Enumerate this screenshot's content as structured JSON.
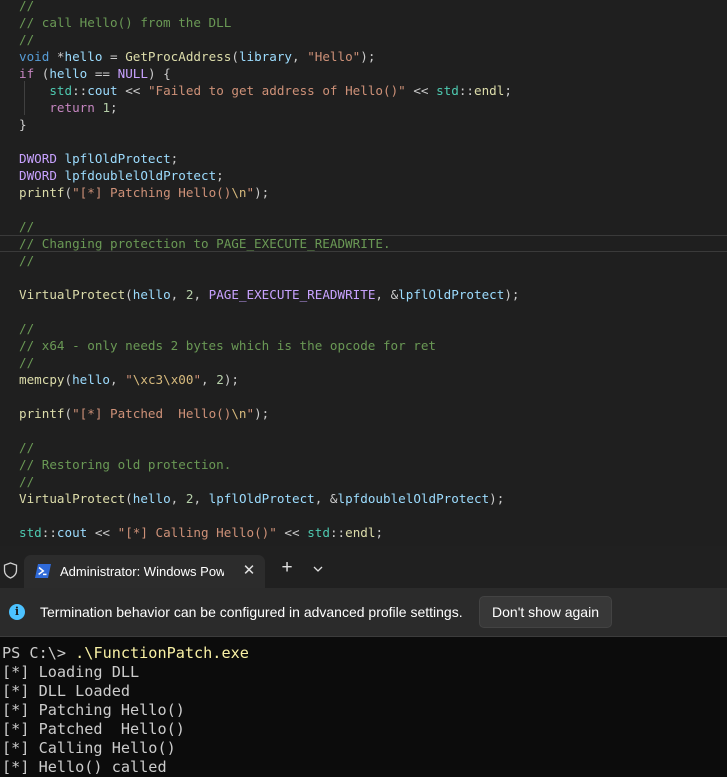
{
  "editor": {
    "lines": [
      [
        {
          "t": "//",
          "c": "comment"
        }
      ],
      [
        {
          "t": "// call Hello() from the DLL",
          "c": "comment"
        }
      ],
      [
        {
          "t": "//",
          "c": "comment"
        }
      ],
      [
        {
          "t": "void",
          "c": "keyword"
        },
        {
          "t": " *",
          "c": "text"
        },
        {
          "t": "hello",
          "c": "var"
        },
        {
          "t": " = ",
          "c": "text"
        },
        {
          "t": "GetProcAddress",
          "c": "func"
        },
        {
          "t": "(",
          "c": "text"
        },
        {
          "t": "library",
          "c": "var"
        },
        {
          "t": ", ",
          "c": "text"
        },
        {
          "t": "\"Hello\"",
          "c": "string"
        },
        {
          "t": ");",
          "c": "text"
        }
      ],
      [
        {
          "t": "if",
          "c": "control"
        },
        {
          "t": " (",
          "c": "text"
        },
        {
          "t": "hello",
          "c": "var"
        },
        {
          "t": " == ",
          "c": "text"
        },
        {
          "t": "NULL",
          "c": "macro"
        },
        {
          "t": ") {",
          "c": "text"
        }
      ],
      [
        {
          "t": "    ",
          "c": "text"
        },
        {
          "t": "std",
          "c": "type"
        },
        {
          "t": "::",
          "c": "text"
        },
        {
          "t": "cout",
          "c": "var"
        },
        {
          "t": " << ",
          "c": "text"
        },
        {
          "t": "\"Failed to get address of Hello()\"",
          "c": "string"
        },
        {
          "t": " << ",
          "c": "text"
        },
        {
          "t": "std",
          "c": "type"
        },
        {
          "t": "::",
          "c": "text"
        },
        {
          "t": "endl",
          "c": "func"
        },
        {
          "t": ";",
          "c": "text"
        }
      ],
      [
        {
          "t": "    ",
          "c": "text"
        },
        {
          "t": "return",
          "c": "control"
        },
        {
          "t": " ",
          "c": "text"
        },
        {
          "t": "1",
          "c": "number"
        },
        {
          "t": ";",
          "c": "text"
        }
      ],
      [
        {
          "t": "}",
          "c": "text"
        }
      ],
      [],
      [
        {
          "t": "DWORD",
          "c": "macro"
        },
        {
          "t": " ",
          "c": "text"
        },
        {
          "t": "lpflOldProtect",
          "c": "var"
        },
        {
          "t": ";",
          "c": "text"
        }
      ],
      [
        {
          "t": "DWORD",
          "c": "macro"
        },
        {
          "t": " ",
          "c": "text"
        },
        {
          "t": "lpfdoublelOldProtect",
          "c": "var"
        },
        {
          "t": ";",
          "c": "text"
        }
      ],
      [
        {
          "t": "printf",
          "c": "func"
        },
        {
          "t": "(",
          "c": "text"
        },
        {
          "t": "\"[*] Patching Hello()",
          "c": "string"
        },
        {
          "t": "\\n",
          "c": "escape"
        },
        {
          "t": "\"",
          "c": "string"
        },
        {
          "t": ");",
          "c": "text"
        }
      ],
      [],
      [
        {
          "t": "//",
          "c": "comment"
        }
      ],
      [
        {
          "t": "// Changing protection to PAGE_EXECUTE_READWRITE.",
          "c": "comment"
        }
      ],
      [
        {
          "t": "//",
          "c": "comment"
        }
      ],
      [],
      [
        {
          "t": "VirtualProtect",
          "c": "func"
        },
        {
          "t": "(",
          "c": "text"
        },
        {
          "t": "hello",
          "c": "var"
        },
        {
          "t": ", ",
          "c": "text"
        },
        {
          "t": "2",
          "c": "number"
        },
        {
          "t": ", ",
          "c": "text"
        },
        {
          "t": "PAGE_EXECUTE_READWRITE",
          "c": "macro"
        },
        {
          "t": ", &",
          "c": "text"
        },
        {
          "t": "lpflOldProtect",
          "c": "var"
        },
        {
          "t": ");",
          "c": "text"
        }
      ],
      [],
      [
        {
          "t": "//",
          "c": "comment"
        }
      ],
      [
        {
          "t": "// x64 - only needs 2 bytes which is the opcode for ret",
          "c": "comment"
        }
      ],
      [
        {
          "t": "//",
          "c": "comment"
        }
      ],
      [
        {
          "t": "memcpy",
          "c": "func"
        },
        {
          "t": "(",
          "c": "text"
        },
        {
          "t": "hello",
          "c": "var"
        },
        {
          "t": ", ",
          "c": "text"
        },
        {
          "t": "\"",
          "c": "string"
        },
        {
          "t": "\\xc3\\x00",
          "c": "escape"
        },
        {
          "t": "\"",
          "c": "string"
        },
        {
          "t": ", ",
          "c": "text"
        },
        {
          "t": "2",
          "c": "number"
        },
        {
          "t": ");",
          "c": "text"
        }
      ],
      [],
      [
        {
          "t": "printf",
          "c": "func"
        },
        {
          "t": "(",
          "c": "text"
        },
        {
          "t": "\"[*] Patched  Hello()",
          "c": "string"
        },
        {
          "t": "\\n",
          "c": "escape"
        },
        {
          "t": "\"",
          "c": "string"
        },
        {
          "t": ");",
          "c": "text"
        }
      ],
      [],
      [
        {
          "t": "//",
          "c": "comment"
        }
      ],
      [
        {
          "t": "// Restoring old protection.",
          "c": "comment"
        }
      ],
      [
        {
          "t": "//",
          "c": "comment"
        }
      ],
      [
        {
          "t": "VirtualProtect",
          "c": "func"
        },
        {
          "t": "(",
          "c": "text"
        },
        {
          "t": "hello",
          "c": "var"
        },
        {
          "t": ", ",
          "c": "text"
        },
        {
          "t": "2",
          "c": "number"
        },
        {
          "t": ", ",
          "c": "text"
        },
        {
          "t": "lpflOldProtect",
          "c": "var"
        },
        {
          "t": ", &",
          "c": "text"
        },
        {
          "t": "lpfdoublelOldProtect",
          "c": "var"
        },
        {
          "t": ");",
          "c": "text"
        }
      ],
      [],
      [
        {
          "t": "std",
          "c": "type"
        },
        {
          "t": "::",
          "c": "text"
        },
        {
          "t": "cout",
          "c": "var"
        },
        {
          "t": " << ",
          "c": "text"
        },
        {
          "t": "\"[*] Calling Hello()\"",
          "c": "string"
        },
        {
          "t": " << ",
          "c": "text"
        },
        {
          "t": "std",
          "c": "type"
        },
        {
          "t": "::",
          "c": "text"
        },
        {
          "t": "endl",
          "c": "func"
        },
        {
          "t": ";",
          "c": "text"
        }
      ]
    ]
  },
  "tabbar": {
    "shield_icon": "shield-icon",
    "tab_icon": "powershell-icon",
    "tab_title": "Administrator: Windows PowerShell",
    "close_glyph": "✕",
    "new_tab_glyph": "+",
    "dropdown_icon": "chevron-down-icon"
  },
  "infobar": {
    "icon": "info-icon",
    "icon_glyph": "i",
    "message": "Termination behavior can be configured in advanced profile settings.",
    "button_label": "Don't show again"
  },
  "terminal": {
    "prompt": "PS C:\\> ",
    "command": ".\\FunctionPatch.exe",
    "output": [
      "[*] Loading DLL",
      "[*] DLL Loaded",
      "[*] Patching Hello()",
      "[*] Patched  Hello()",
      "[*] Calling Hello()",
      "[*] Hello() called"
    ]
  },
  "colors": {
    "editor_bg": "#1f1f1f",
    "terminal_bg": "#0c0c0c",
    "accent_info": "#4cc2ff",
    "powershell_blue": "#2f6ad8"
  }
}
